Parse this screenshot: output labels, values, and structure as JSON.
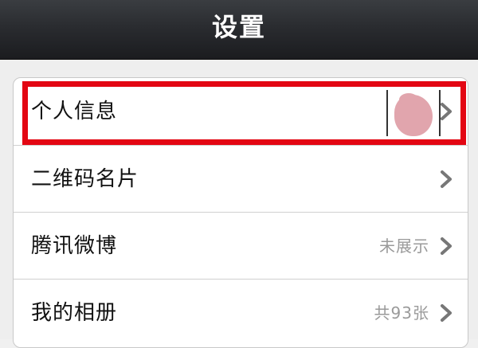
{
  "header": {
    "title": "设置"
  },
  "settings": {
    "rows": [
      {
        "label": "个人信息",
        "value": ""
      },
      {
        "label": "二维码名片",
        "value": ""
      },
      {
        "label": "腾讯微博",
        "value": "未展示"
      },
      {
        "label": "我的相册",
        "value": "共93张"
      }
    ]
  },
  "icons": {
    "chevron": "chevron-right-icon",
    "avatar": "avatar-thumbnail"
  },
  "colors": {
    "nav_bar": "#2a2c30",
    "highlight": "#e30613",
    "value_text": "#9a9a9a",
    "avatar_blur": "#e1a5ad"
  }
}
